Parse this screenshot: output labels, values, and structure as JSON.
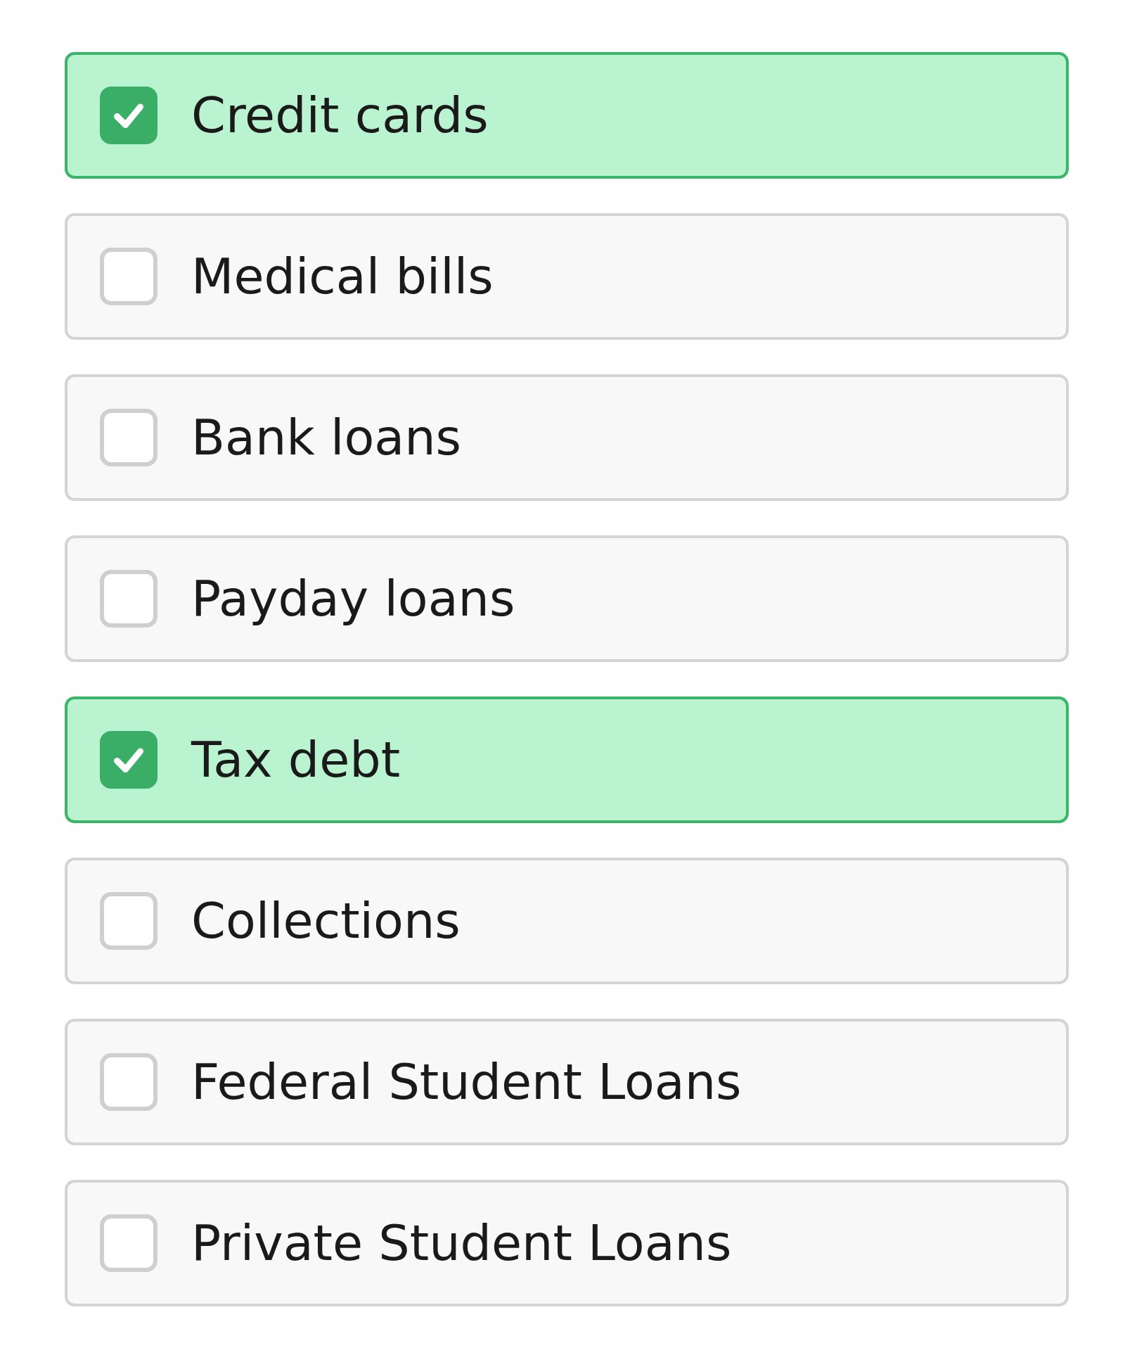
{
  "options": [
    {
      "label": "Credit cards",
      "checked": true
    },
    {
      "label": "Medical bills",
      "checked": false
    },
    {
      "label": "Bank loans",
      "checked": false
    },
    {
      "label": "Payday loans",
      "checked": false
    },
    {
      "label": "Tax debt",
      "checked": true
    },
    {
      "label": "Collections",
      "checked": false
    },
    {
      "label": "Federal Student Loans",
      "checked": false
    },
    {
      "label": "Private Student Loans",
      "checked": false
    }
  ]
}
